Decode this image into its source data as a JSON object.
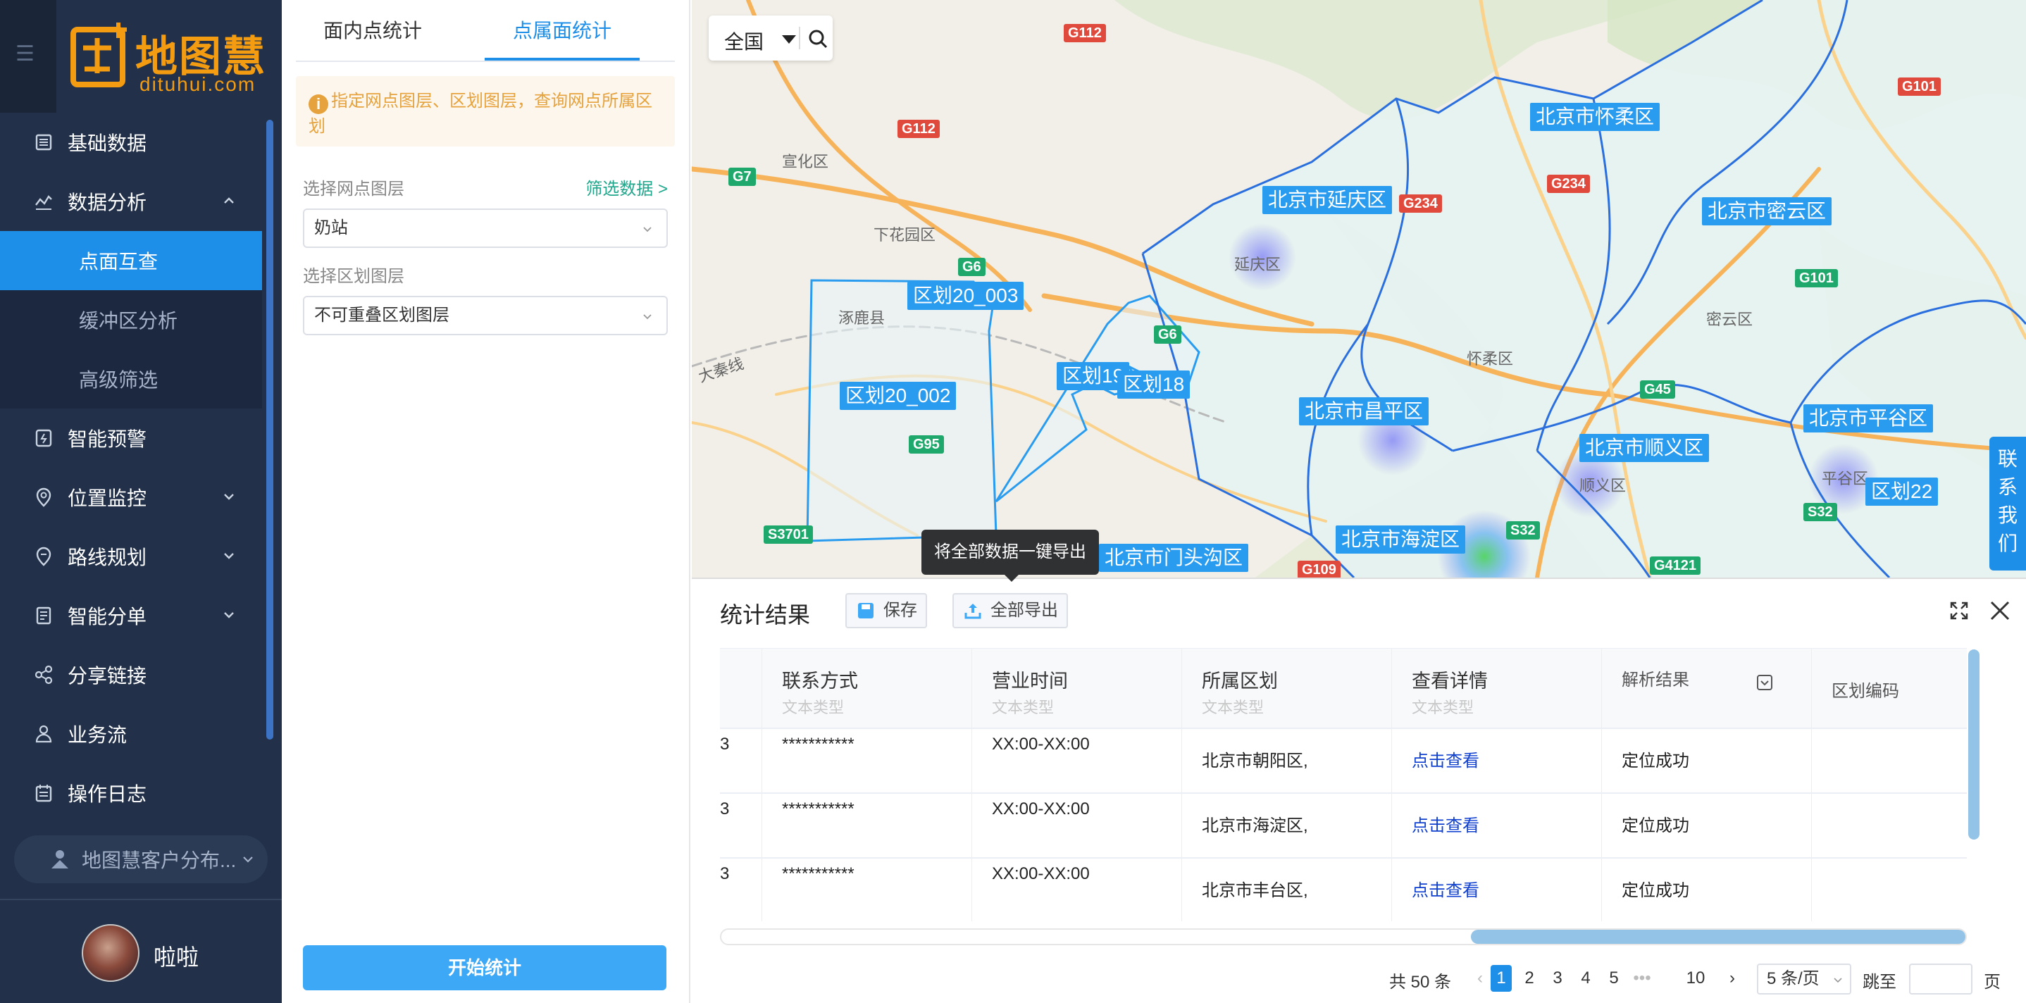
{
  "brand": {
    "name": "地图慧",
    "domain": "dituhui.com",
    "color": "#f39c12"
  },
  "sidebar": {
    "items": [
      {
        "label": "基础数据",
        "icon": "database-icon"
      },
      {
        "label": "数据分析",
        "icon": "analysis-icon",
        "expanded": true,
        "children": [
          {
            "label": "点面互查",
            "active": true
          },
          {
            "label": "缓冲区分析"
          },
          {
            "label": "高级筛选"
          }
        ]
      },
      {
        "label": "智能预警",
        "icon": "alert-icon"
      },
      {
        "label": "位置监控",
        "icon": "location-icon"
      },
      {
        "label": "路线规划",
        "icon": "route-icon"
      },
      {
        "label": "智能分单",
        "icon": "dispatch-icon"
      },
      {
        "label": "分享链接",
        "icon": "share-icon"
      },
      {
        "label": "业务流",
        "icon": "workflow-icon"
      },
      {
        "label": "操作日志",
        "icon": "log-icon"
      }
    ],
    "workspace": "地图慧客户分布...",
    "user": "啦啦",
    "accent": "#1e8fe8"
  },
  "panel": {
    "tabs": [
      "面内点统计",
      "点属面统计"
    ],
    "active_tab": 1,
    "tip": "指定网点图层、区划图层，查询网点所属区划",
    "point_layer_label": "选择网点图层",
    "filter_link": "筛选数据 >",
    "point_layer_value": "奶站",
    "region_layer_label": "选择区划图层",
    "region_layer_value": "不可重叠区划图层",
    "start_button": "开始统计"
  },
  "map": {
    "region_select": "全国",
    "district_labels": [
      "北京市怀柔区",
      "北京市延庆区",
      "北京市密云区",
      "区划20_003",
      "区划20_002",
      "区划19",
      "区划18",
      "北京市昌平区",
      "北京市顺义区",
      "北京市平谷区",
      "区划22",
      "北京市海淀区",
      "北京市门头沟区"
    ],
    "road_labels_red": [
      "G112",
      "G112",
      "G101",
      "G234",
      "G234",
      "G109"
    ],
    "road_labels_green": [
      "G7",
      "G6",
      "G6",
      "G95",
      "S3701",
      "G101",
      "G45",
      "S32",
      "S32",
      "G4121"
    ],
    "place_names": [
      "宣化区",
      "下花园区",
      "涿鹿县",
      "延庆区",
      "怀柔区",
      "密云区",
      "顺义区",
      "平谷区",
      "大秦线"
    ],
    "contact": "联系我们",
    "tooltip": "将全部数据一键导出"
  },
  "results": {
    "title": "统计结果",
    "save_button": "保存",
    "export_button": "全部导出",
    "columns": [
      {
        "title": "联系方式",
        "type": "文本类型"
      },
      {
        "title": "营业时间",
        "type": "文本类型"
      },
      {
        "title": "所属区划",
        "type": "文本类型"
      },
      {
        "title": "查看详情",
        "type": "文本类型"
      },
      {
        "title": "解析结果",
        "type": ""
      },
      {
        "title": "区划编码",
        "type": ""
      }
    ],
    "rows": [
      {
        "lead": "3",
        "contact": "***********",
        "hours": "XX:00-XX:00",
        "region": "北京市朝阳区,",
        "detail": "点击查看",
        "result": "定位成功",
        "code": ""
      },
      {
        "lead": "3",
        "contact": "***********",
        "hours": "XX:00-XX:00",
        "region": "北京市海淀区,",
        "detail": "点击查看",
        "result": "定位成功",
        "code": ""
      },
      {
        "lead": "3",
        "contact": "***********",
        "hours": "XX:00-XX:00",
        "region": "北京市丰台区,",
        "detail": "点击查看",
        "result": "定位成功",
        "code": ""
      }
    ],
    "pagination": {
      "total": "共 50 条",
      "pages": [
        "1",
        "2",
        "3",
        "4",
        "5",
        "•••",
        "10"
      ],
      "current": "1",
      "page_size": "5 条/页",
      "jump_label": "跳至",
      "jump_unit": "页"
    }
  }
}
